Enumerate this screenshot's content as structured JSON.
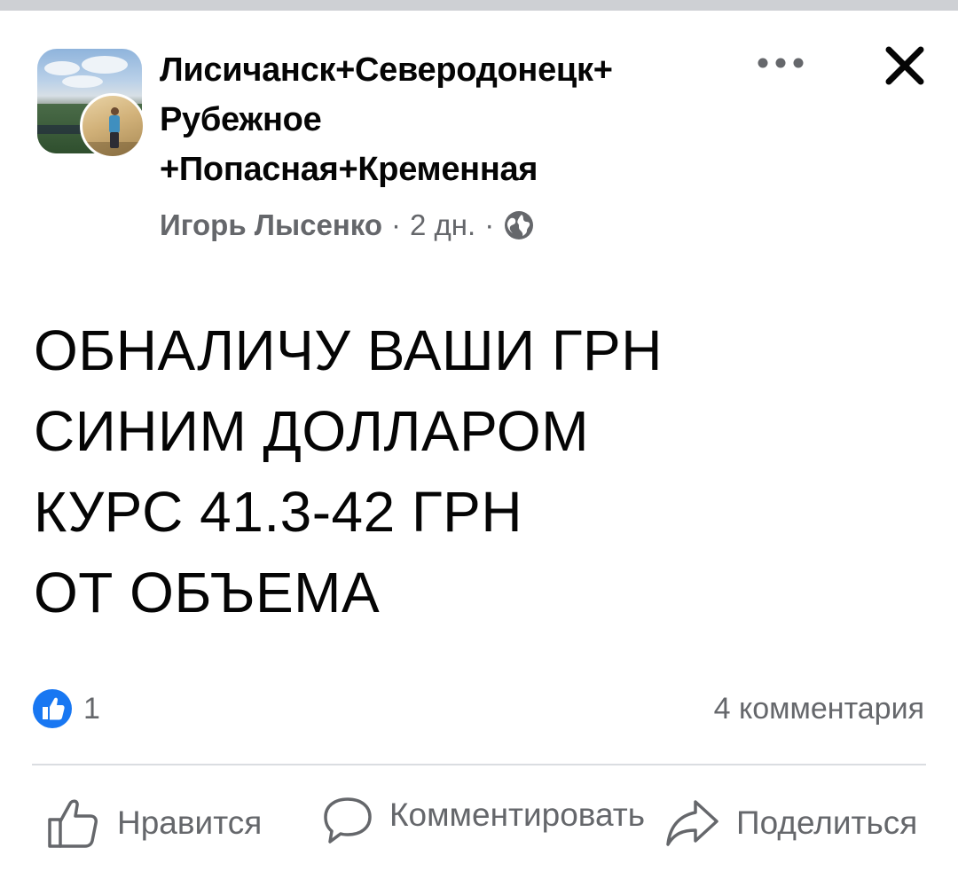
{
  "post": {
    "group_name_lines": [
      "Лисичанск+Северодонецк+",
      "Рубежное",
      "+Попасная+Кременная"
    ],
    "author": "Игорь Лысенко",
    "separator": "·",
    "time": "2 дн.",
    "body_lines": [
      "ОБНАЛИЧУ ВАШИ ГРН",
      "СИНИМ ДОЛЛАРОМ",
      "КУРС 41.3-42 ГРН",
      "ОТ ОБЪЕМА"
    ]
  },
  "icons": {
    "more": "more-horizontal-icon",
    "close": "close-icon",
    "audience": "globe-icon",
    "reaction": "like-reaction-icon",
    "like": "thumbs-up-icon",
    "comment": "comment-bubble-icon",
    "share": "share-arrow-icon"
  },
  "stats": {
    "reaction_count": "1",
    "comments": "4 комментария"
  },
  "actions": {
    "like_label": "Нравится",
    "comment_label": "Комментировать",
    "share_label": "Поделиться"
  },
  "colors": {
    "text_primary": "#050505",
    "text_secondary": "#65676b",
    "like_blue": "#1877f2",
    "divider": "#dadde1"
  }
}
